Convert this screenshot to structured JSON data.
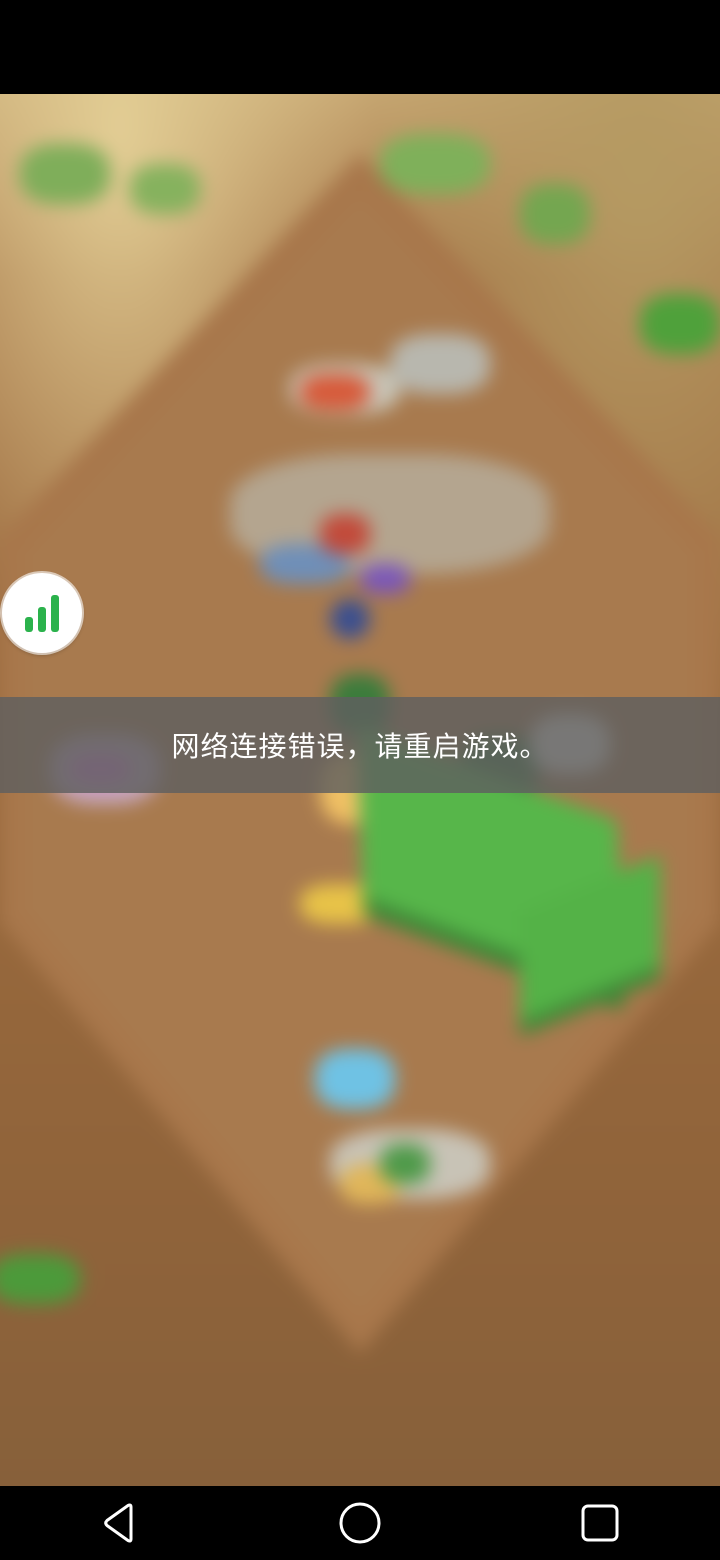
{
  "error_banner": {
    "message": "网络连接错误，请重启游戏。"
  },
  "floating_button": {
    "icon": "signal-bars-icon",
    "icon_color": "#2bb24c"
  },
  "navigation_bar": {
    "buttons": [
      {
        "icon": "back-triangle-icon"
      },
      {
        "icon": "home-circle-icon"
      },
      {
        "icon": "recents-square-icon"
      }
    ]
  },
  "colors": {
    "banner_background": "#5f5f5f",
    "banner_text": "#ffffff",
    "nav_icon": "#ffffff"
  }
}
